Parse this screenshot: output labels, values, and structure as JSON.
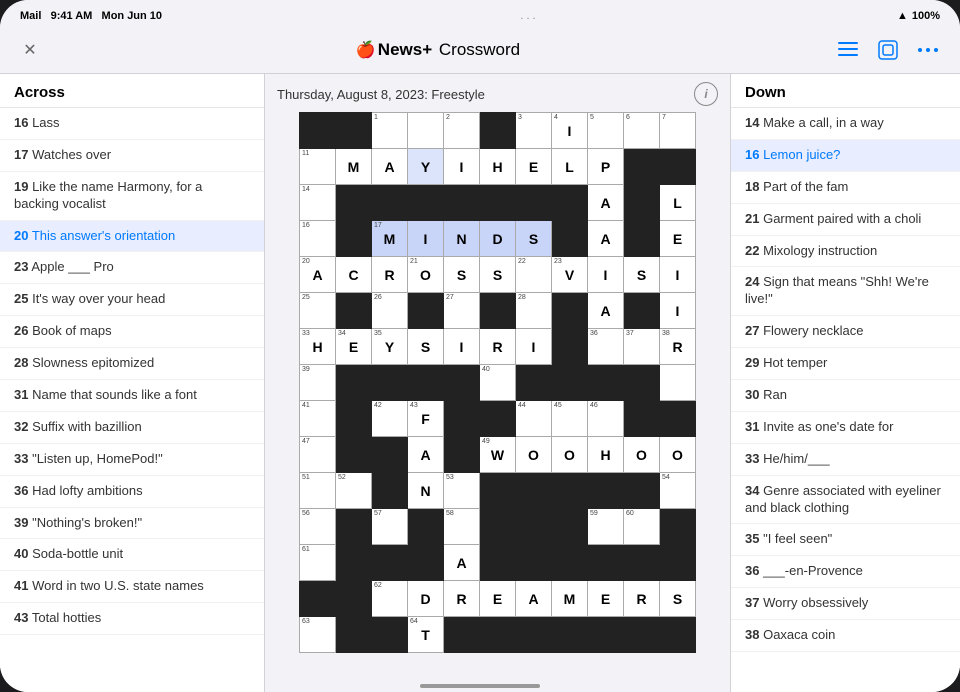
{
  "statusBar": {
    "app": "Mail",
    "time": "9:41 AM",
    "date": "Mon Jun 10",
    "ellipsis": "...",
    "wifi": "WiFi",
    "battery": "100%"
  },
  "navBar": {
    "closeLabel": "✕",
    "logoSymbol": "",
    "newsPlus": "News+",
    "separator": " ",
    "crossword": "Crossword",
    "listIcon": "☰",
    "profileIcon": "⊡",
    "moreIcon": "•••"
  },
  "crossword": {
    "dateTitle": "Thursday, August 8, 2023: Freestyle",
    "infoLabel": "i"
  },
  "acrossHeader": "Across",
  "acrossClues": [
    {
      "num": "16",
      "clue": "Lass"
    },
    {
      "num": "17",
      "clue": "Watches over"
    },
    {
      "num": "19",
      "clue": "Like the name Harmony, for a backing vocalist"
    },
    {
      "num": "20",
      "clue": "This answer's orientation",
      "active": true
    },
    {
      "num": "23",
      "clue": "Apple ___ Pro"
    },
    {
      "num": "25",
      "clue": "It's way over your head"
    },
    {
      "num": "26",
      "clue": "Book of maps"
    },
    {
      "num": "28",
      "clue": "Slowness epitomized"
    },
    {
      "num": "31",
      "clue": "Name that sounds like a font"
    },
    {
      "num": "32",
      "clue": "Suffix with bazillion"
    },
    {
      "num": "33",
      "clue": "\"Listen up, HomePod!\""
    },
    {
      "num": "36",
      "clue": "Had lofty ambitions"
    },
    {
      "num": "39",
      "clue": "\"Nothing's broken!\""
    },
    {
      "num": "40",
      "clue": "Soda-bottle unit"
    },
    {
      "num": "41",
      "clue": "Word in two U.S. state names"
    },
    {
      "num": "43",
      "clue": "Total hotties"
    }
  ],
  "downHeader": "Down",
  "downClues": [
    {
      "num": "14",
      "clue": "Make a call, in a way"
    },
    {
      "num": "16",
      "clue": "Lemon juice?",
      "active": true
    },
    {
      "num": "18",
      "clue": "Part of the fam"
    },
    {
      "num": "21",
      "clue": "Garment paired with a choli"
    },
    {
      "num": "22",
      "clue": "Mixology instruction"
    },
    {
      "num": "24",
      "clue": "Sign that means \"Shh! We're live!\""
    },
    {
      "num": "27",
      "clue": "Flowery necklace"
    },
    {
      "num": "29",
      "clue": "Hot temper"
    },
    {
      "num": "30",
      "clue": "Ran"
    },
    {
      "num": "31",
      "clue": "Invite as one's date for"
    },
    {
      "num": "33",
      "clue": "He/him/___"
    },
    {
      "num": "34",
      "clue": "Genre associated with eyeliner and black clothing"
    },
    {
      "num": "35",
      "clue": "\"I feel seen\""
    },
    {
      "num": "36",
      "clue": "___-en-Provence"
    },
    {
      "num": "37",
      "clue": "Worry obsessively"
    },
    {
      "num": "38",
      "clue": "Oaxaca coin"
    }
  ]
}
